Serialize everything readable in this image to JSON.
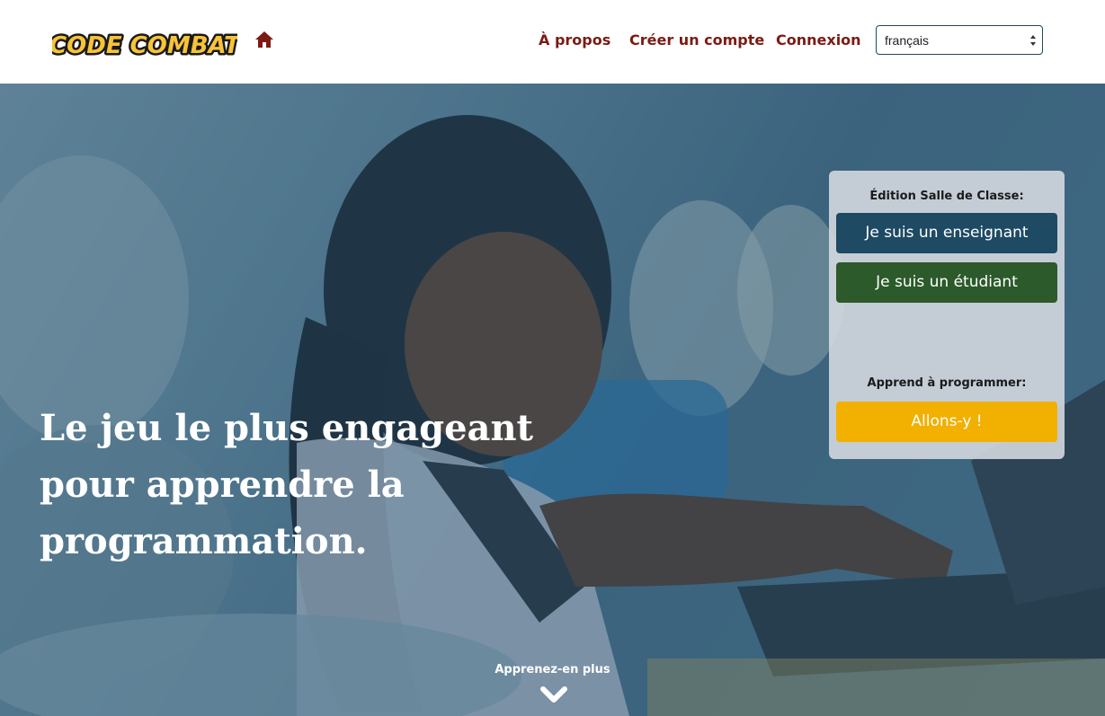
{
  "header": {
    "logo_text": "CODE COMBAT",
    "home_icon": "home-icon",
    "nav": {
      "about": "À propos",
      "create_account": "Créer un compte",
      "login": "Connexion"
    },
    "language": {
      "selected": "français"
    }
  },
  "hero": {
    "headline": "Le jeu le plus engageant pour apprendre la programmation.",
    "panel": {
      "classroom_label": "Édition Salle de Classe:",
      "teacher_button": "Je suis un enseignant",
      "student_button": "Je suis un étudiant",
      "learn_label": "Apprend à programmer:",
      "go_button": "Allons-y !"
    },
    "learn_more": "Apprenez-en plus",
    "learn_more_icon": "chevron-down-icon"
  },
  "colors": {
    "nav_link": "#7b1b14",
    "teacher_button": "#1e4a63",
    "student_button": "#2c5a2a",
    "go_button": "#f2b000",
    "hero_overlay": "#235573"
  }
}
